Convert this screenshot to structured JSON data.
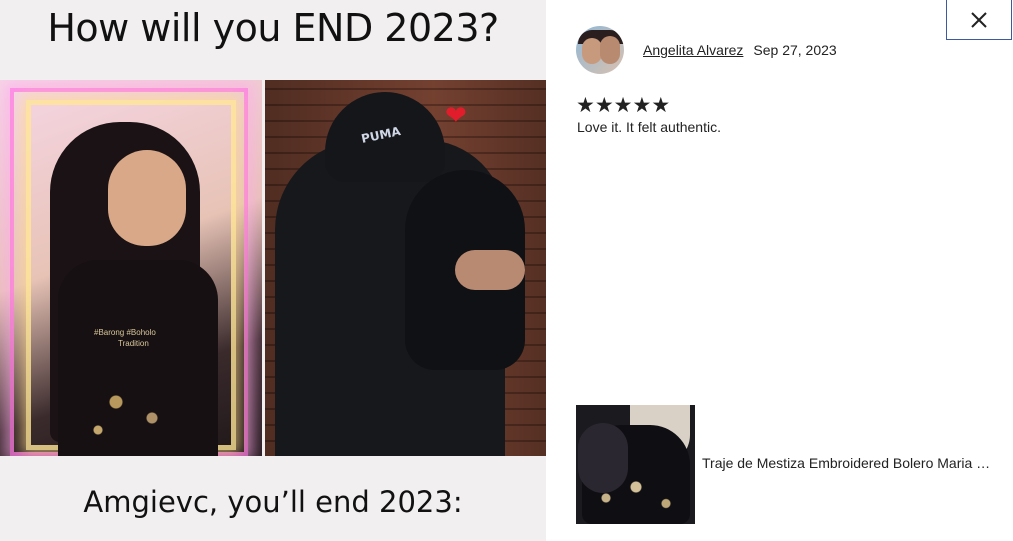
{
  "left_panel": {
    "heading": "How will you END 2023?",
    "footer": "Amgievc, you’ll end 2023:",
    "photo_left": {
      "overlay_text_1": "#Barong #Boholo",
      "overlay_text_2": "Tradition"
    },
    "photo_right": {
      "cap_logo": "PUMA",
      "heart": "❤"
    }
  },
  "modal": {
    "close_label": "×",
    "close_icon": "close-icon",
    "reviewer": {
      "name": "Angelita Alvarez",
      "date": "Sep 27, 2023"
    },
    "rating": {
      "value": 5,
      "max": 5,
      "star_glyph": "★"
    },
    "review_text": "Love it. It felt authentic.",
    "product": {
      "title": "Traje de Mestiza Embroidered Bolero Maria Clara"
    }
  },
  "colors": {
    "close_border": "#3d5a9e",
    "text": "#222222",
    "heart": "#e11d2c"
  }
}
